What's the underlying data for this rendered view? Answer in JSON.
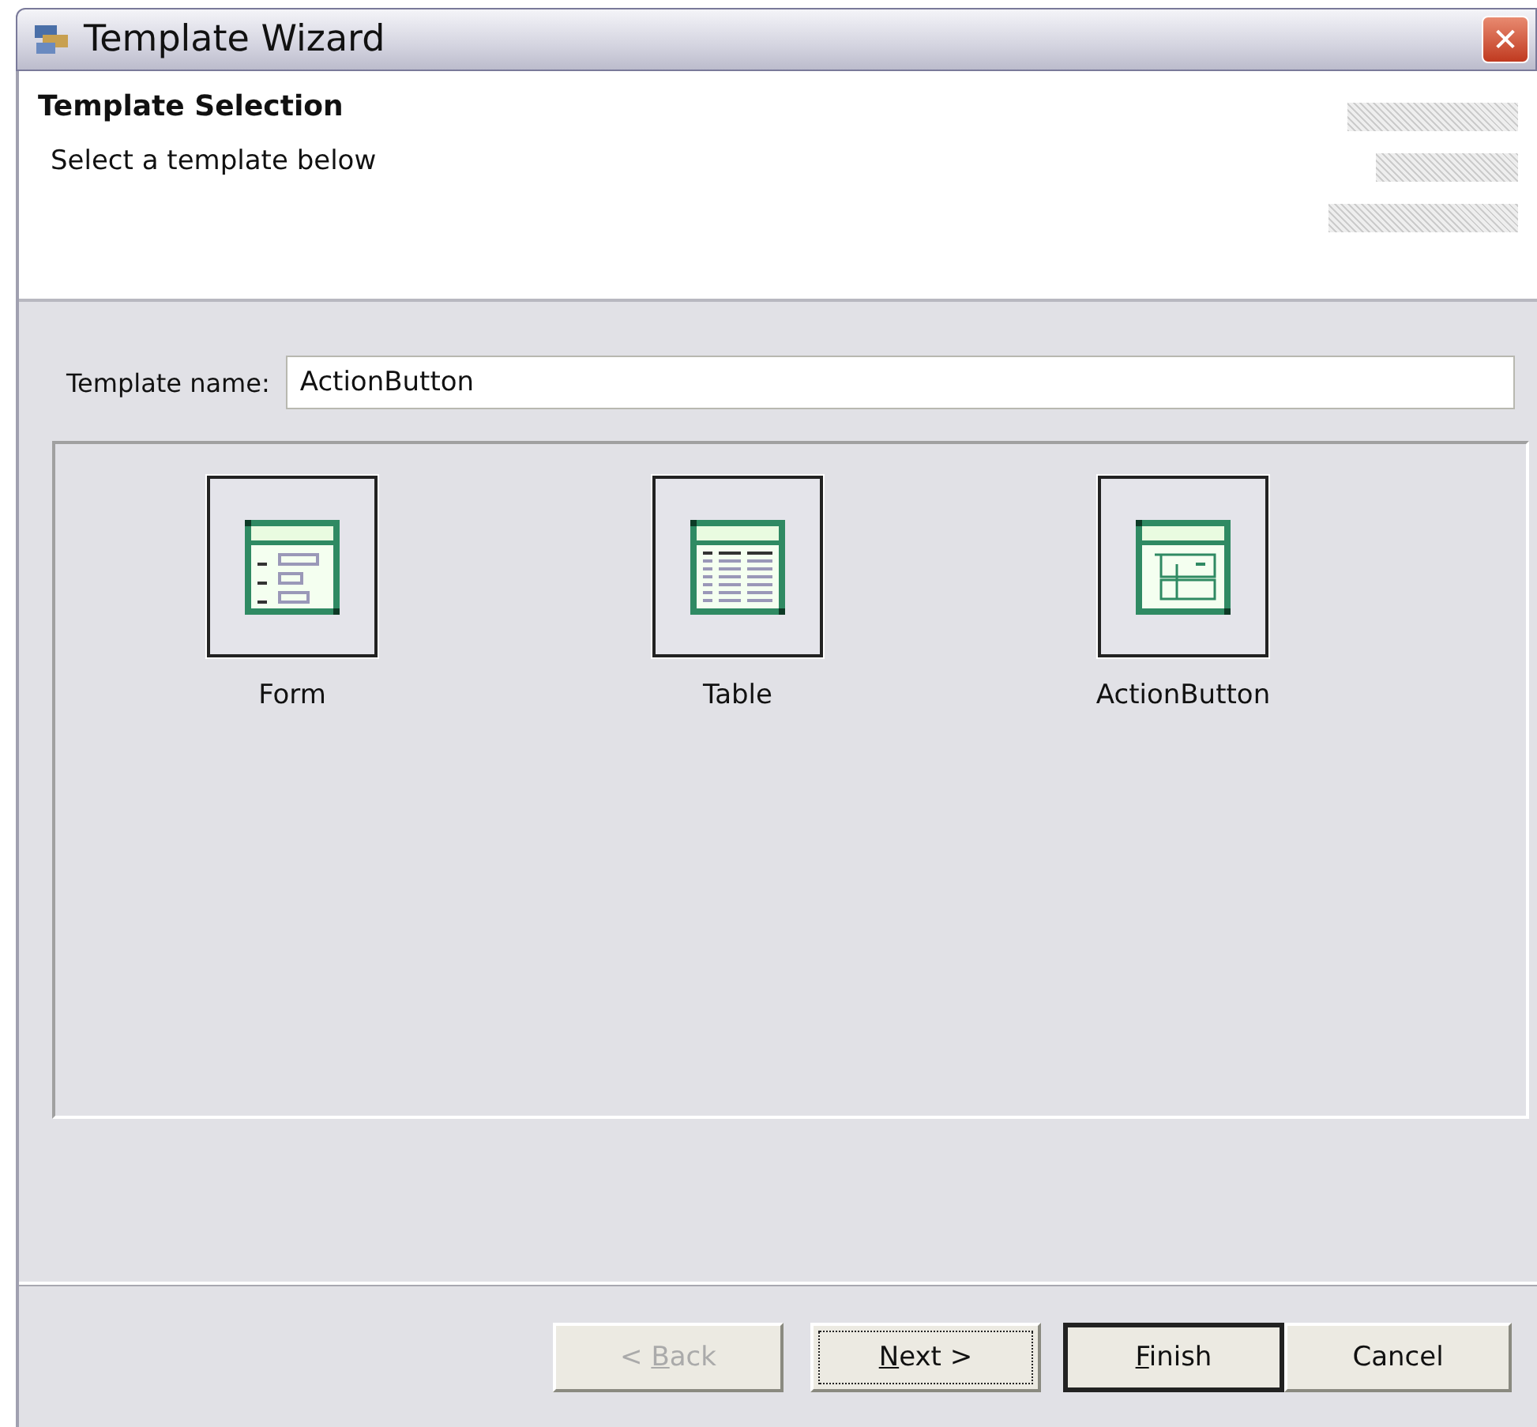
{
  "window": {
    "title": "Template Wizard",
    "close": "✕"
  },
  "header": {
    "title": "Template Selection",
    "subtitle": "Select a template below"
  },
  "template_name": {
    "label": "Template name:",
    "value": "ActionButton"
  },
  "templates": [
    {
      "label": "Form",
      "kind": "form"
    },
    {
      "label": "Table",
      "kind": "table"
    },
    {
      "label": "ActionButton",
      "kind": "action"
    }
  ],
  "buttons": [
    {
      "label": "< ",
      "mnemonic": "B",
      "label_after": "ack",
      "disabled": true,
      "focused": false,
      "default": false
    },
    {
      "mnemonic": "N",
      "label_after": "ext >",
      "disabled": false,
      "focused": true,
      "default": false
    },
    {
      "mnemonic": "F",
      "label_after": "inish",
      "disabled": false,
      "focused": false,
      "default": true
    },
    {
      "label": "Cancel",
      "disabled": false,
      "focused": false,
      "default": false
    }
  ]
}
